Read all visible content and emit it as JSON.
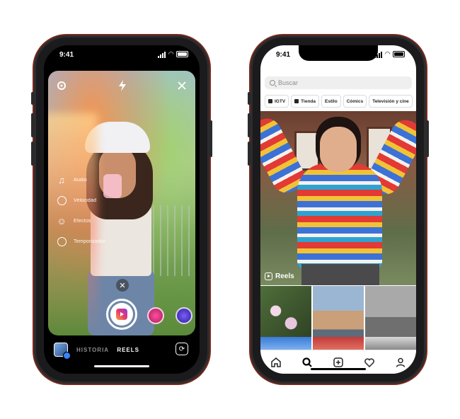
{
  "status_bar": {
    "time": "9:41"
  },
  "camera": {
    "menu": [
      {
        "label": "Audio",
        "icon": "music-note-icon"
      },
      {
        "label": "Velocidad",
        "icon": "speed-icon"
      },
      {
        "label": "Efectos",
        "icon": "effects-smile-icon"
      },
      {
        "label": "Temporizador",
        "icon": "timer-icon"
      }
    ],
    "modes": {
      "story": "HISTORIA",
      "reels": "REELS"
    },
    "active_mode": "REELS",
    "colors": {
      "accent_reels": "#e63a6c",
      "mode_inactive": "#8e8e93"
    }
  },
  "explore": {
    "search_placeholder": "Buscar",
    "chips": [
      {
        "label": "IGTV",
        "icon": "tv-icon"
      },
      {
        "label": "Tienda",
        "icon": "shop-bag-icon"
      },
      {
        "label": "Estilo"
      },
      {
        "label": "Cómics"
      },
      {
        "label": "Televisión y cine"
      }
    ],
    "reels_label": "Reels",
    "tabs": [
      "home-icon",
      "search-icon",
      "create-post-icon",
      "activity-heart-icon",
      "profile-icon"
    ]
  }
}
